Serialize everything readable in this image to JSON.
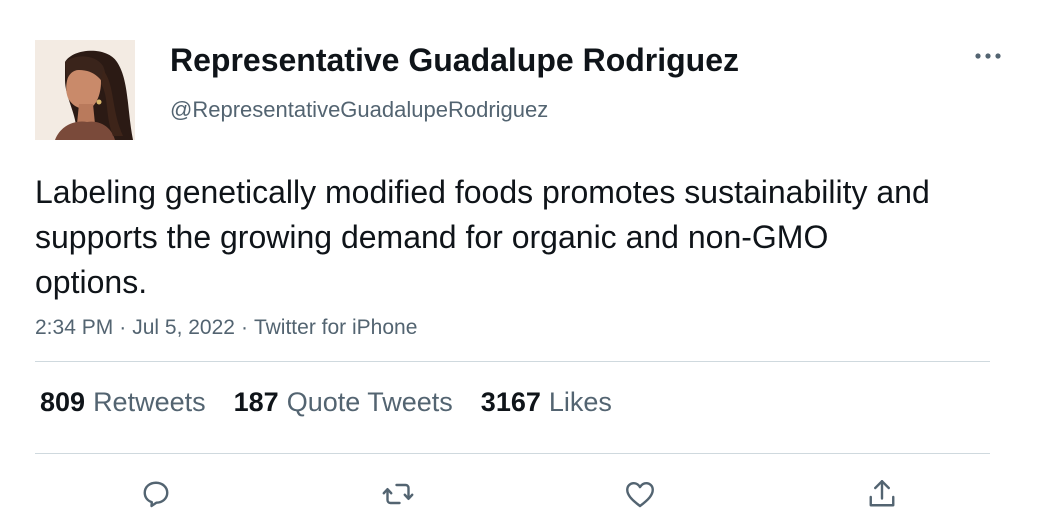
{
  "author": {
    "display_name": "Representative Guadalupe Rodriguez",
    "handle": "@RepresentativeGuadalupeRodriguez",
    "avatar_icon": "person-portrait-avatar"
  },
  "tweet": {
    "text": "Labeling genetically modified foods promotes sustainability and supports the growing demand for organic and non-GMO options.",
    "time": "2:34 PM",
    "date": "Jul 5, 2022",
    "source": "Twitter for iPhone",
    "separator": "·"
  },
  "stats": {
    "retweets_count": "809",
    "retweets_label": "Retweets",
    "quotes_count": "187",
    "quotes_label": "Quote Tweets",
    "likes_count": "3167",
    "likes_label": "Likes"
  },
  "actions": {
    "reply_icon": "reply-icon",
    "retweet_icon": "retweet-icon",
    "like_icon": "heart-icon",
    "share_icon": "share-icon",
    "more_icon": "more-icon"
  },
  "colors": {
    "text_primary": "#0f1419",
    "text_secondary": "#536471",
    "divider": "#cfd9de"
  }
}
